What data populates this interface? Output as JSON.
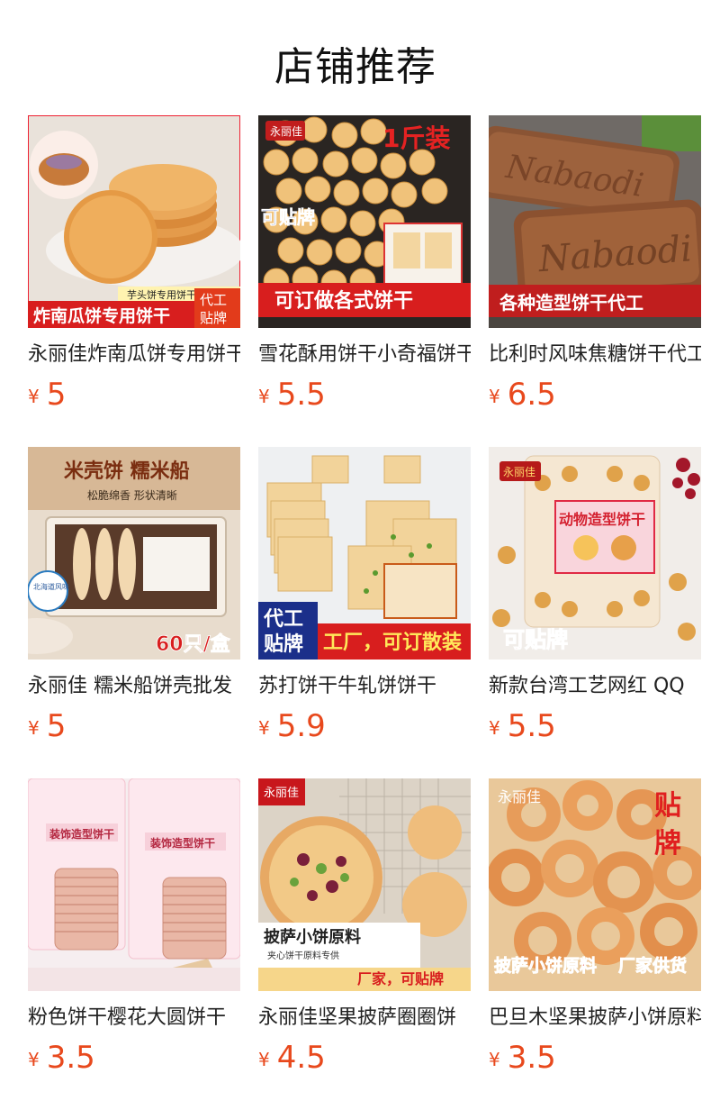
{
  "header": {
    "title": "店铺推荐"
  },
  "currency_symbol": "¥",
  "products": [
    {
      "name": "永丽佳炸南瓜饼专用饼干",
      "price": "5",
      "img_texts": [
        "芋头饼专用饼干",
        "炸南瓜饼专用饼干",
        "代工",
        "贴牌"
      ]
    },
    {
      "name": "雪花酥用饼干小奇福饼干",
      "price": "5.5",
      "img_texts": [
        "永丽佳",
        "1斤装",
        "可贴牌",
        "可订做各式饼干"
      ]
    },
    {
      "name": "比利时风味焦糖饼干代工",
      "price": "6.5",
      "img_texts": [
        "Nabaodi",
        "Nabaodi",
        "各种造型饼干代工"
      ]
    },
    {
      "name": "永丽佳 糯米船饼壳批发",
      "price": "5",
      "img_texts": [
        "米壳饼 糯米船",
        "松脆绵香 形状清晰",
        "北海道风味",
        "60只/盒"
      ]
    },
    {
      "name": "苏打饼干牛轧饼饼干",
      "price": "5.9",
      "img_texts": [
        "代工",
        "贴牌",
        "工厂，可订散装"
      ]
    },
    {
      "name": "新款台湾工艺网红 QQ",
      "price": "5.5",
      "img_texts": [
        "永丽佳",
        "动物造型饼干",
        "可贴牌"
      ]
    },
    {
      "name": "粉色饼干樱花大圆饼干",
      "price": "3.5",
      "img_texts": [
        "装饰造型饼干",
        "装饰造型饼干"
      ]
    },
    {
      "name": "永丽佳坚果披萨圈圈饼",
      "price": "4.5",
      "img_texts": [
        "永丽佳",
        "披萨小饼原料",
        "夹心饼干原料专供",
        "厂家，可贴牌"
      ]
    },
    {
      "name": "巴旦木坚果披萨小饼原料",
      "price": "3.5",
      "img_texts": [
        "永丽佳",
        "贴",
        "牌",
        "披萨小饼原料",
        "厂家供货"
      ]
    }
  ],
  "colors": {
    "price": "#e8491d",
    "banner_red": "#d81e1e"
  }
}
